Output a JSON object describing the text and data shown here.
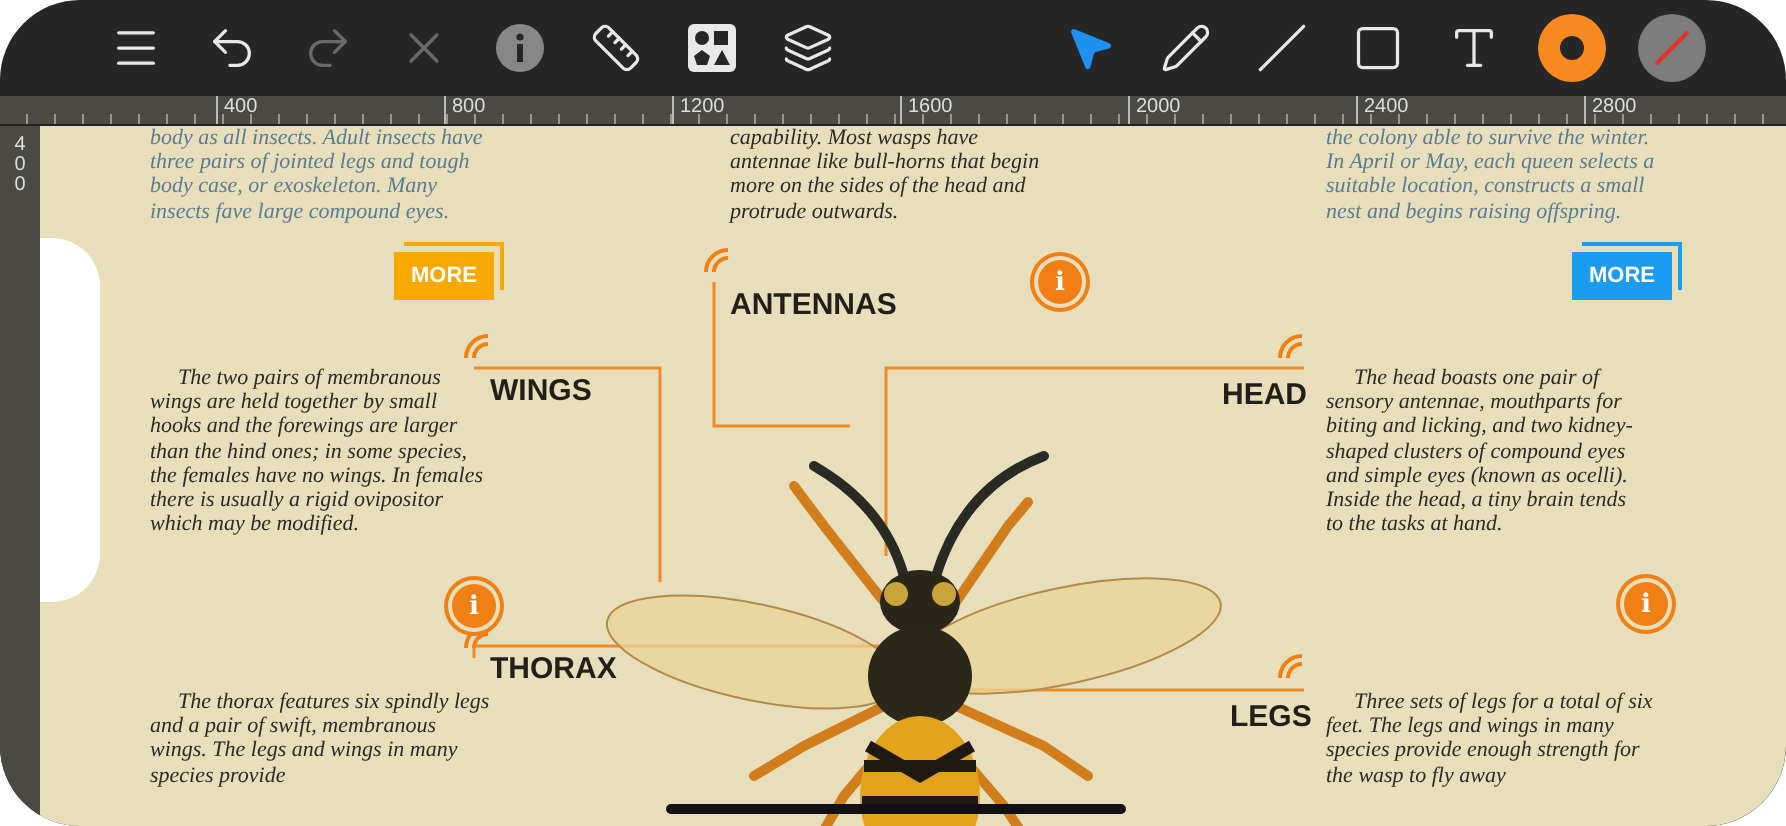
{
  "toolbar": {
    "tools": [
      {
        "kind": "menu",
        "selected": false,
        "disabled": false
      },
      {
        "kind": "undo",
        "selected": false,
        "disabled": false
      },
      {
        "kind": "redo",
        "selected": false,
        "disabled": true
      },
      {
        "kind": "delete",
        "selected": false,
        "disabled": true
      },
      {
        "kind": "info",
        "selected": false,
        "disabled": false
      },
      {
        "kind": "ruler",
        "selected": false,
        "disabled": false
      },
      {
        "kind": "shapes",
        "selected": false,
        "disabled": false
      },
      {
        "kind": "layers",
        "selected": false,
        "disabled": false
      },
      {
        "kind": "pointer",
        "selected": true,
        "disabled": false
      },
      {
        "kind": "pencil",
        "selected": false,
        "disabled": false
      },
      {
        "kind": "line",
        "selected": false,
        "disabled": false
      },
      {
        "kind": "rectangle",
        "selected": false,
        "disabled": false
      },
      {
        "kind": "text",
        "selected": false,
        "disabled": false
      }
    ],
    "swatches": [
      {
        "kind": "stroke",
        "color": "#f7891f"
      },
      {
        "kind": "fill",
        "color": "#7d7d7d"
      }
    ]
  },
  "rulers": {
    "horizontal": [
      "400",
      "800",
      "1200",
      "1600",
      "2000",
      "2400",
      "2800"
    ],
    "vertical": [
      "400"
    ]
  },
  "canvas": {
    "notes": [
      {
        "kind": "teaser",
        "text": "body as all insects. Adult insects have three pairs of jointed legs and tough body case, or exoskeleton. Many insects fave large compound eyes."
      },
      {
        "kind": "body",
        "text": "capability. Most wasps have antennae like bull-horns that begin more on the sides of the head and protrude outwards."
      },
      {
        "kind": "teaser",
        "text": "the colony able to survive the winter. In April or May, each queen selects a suitable location, constructs a small nest and begins raising offspring."
      },
      {
        "kind": "body",
        "text": "The two pairs of membranous wings are held together by small hooks and the forewings are larger than the hind ones; in some species, the females have no wings. In females there is usually a rigid ovipositor which may be modified."
      },
      {
        "kind": "body",
        "text": "The head boasts one pair of sensory antennae, mouthparts for biting and licking, and two kidney-shaped clusters of compound eyes and simple eyes (known as ocelli). Inside the head, a tiny brain tends to the tasks at hand."
      },
      {
        "kind": "body",
        "text": "The thorax features six spindly legs and a pair of swift, membranous wings. The legs and wings in many species provide"
      },
      {
        "kind": "body",
        "text": "Three sets of legs for a total of six feet. The legs and wings in many species provide enough strength for the wasp to fly away"
      }
    ],
    "more_buttons": [
      {
        "label": "MORE",
        "color": "#f9a800"
      },
      {
        "label": "MORE",
        "color": "#1a9cf0"
      }
    ],
    "labels": [
      "ANTENNAS",
      "WINGS",
      "HEAD",
      "THORAX",
      "LEGS"
    ],
    "info_buttons": [
      "i",
      "i",
      "i"
    ]
  }
}
